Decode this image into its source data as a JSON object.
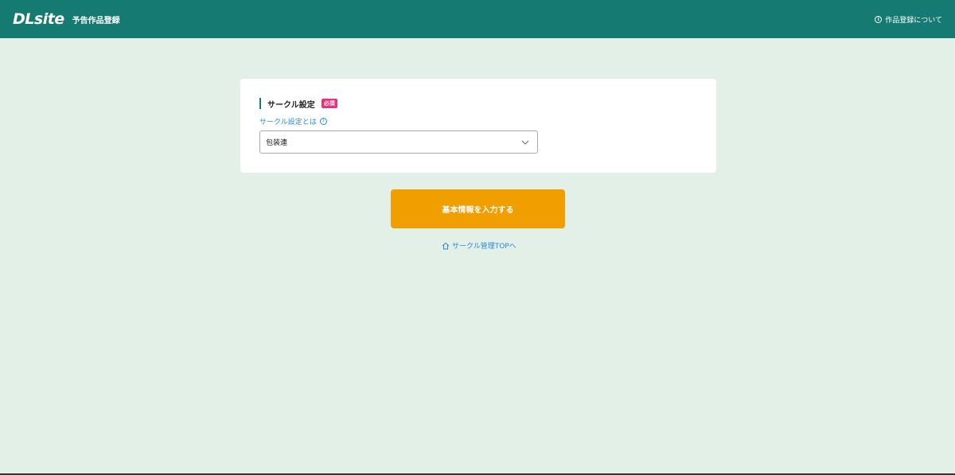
{
  "header": {
    "logo": "DLsite",
    "title": "予告作品登録",
    "about_link": "作品登録について",
    "about_icon": "info-icon"
  },
  "circle_section": {
    "title": "サークル設定",
    "required_badge": "必須",
    "help_link": "サークル設定とは",
    "help_icon": "question-circle-icon",
    "select_value": "包装連",
    "select_icon": "chevron-down-icon"
  },
  "actions": {
    "primary_button": "基本情報を入力する",
    "home_link": "サークル管理TOPへ",
    "home_icon": "home-icon"
  },
  "colors": {
    "header_bg": "#157a72",
    "page_bg": "#e3f0e7",
    "primary": "#f09e00",
    "link": "#2a8bd4",
    "badge": "#e9317b"
  }
}
